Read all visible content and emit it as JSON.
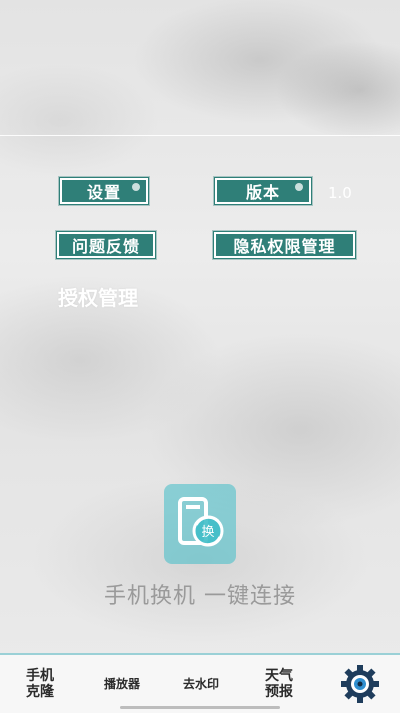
{
  "menu": {
    "settings_label": "设置",
    "version_label": "版本",
    "version_value": "1.0",
    "feedback_label": "问题反馈",
    "privacy_label": "隐私权限管理",
    "auth_label": "授权管理"
  },
  "hero": {
    "icon": "phone-swap-icon",
    "icon_glyph": "换",
    "slogan": "手机换机  一键连接"
  },
  "tabbar": {
    "clone_line1": "手机",
    "clone_line2": "克隆",
    "player": "播放器",
    "watermark": "去水印",
    "weather_line1": "天气",
    "weather_line2": "预报",
    "settings_icon": "gear-icon"
  },
  "colors": {
    "button_bg": "#2f7f78",
    "icon_bg": "#40bec8",
    "tab_accent": "#1f3d5c"
  }
}
